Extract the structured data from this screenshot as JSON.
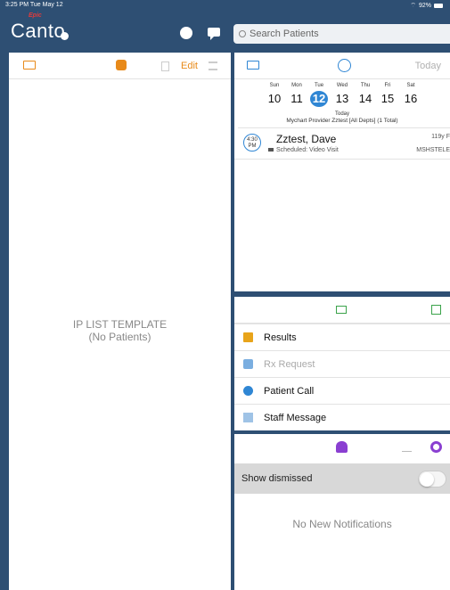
{
  "status_bar": {
    "time": "3:25 PM  Tue May 12",
    "battery": "92%"
  },
  "brand": {
    "epic": "Epic",
    "app_name": "Canto"
  },
  "icons": {
    "globe": "globe-icon",
    "chat": "chat-bubble-icon"
  },
  "search": {
    "placeholder": "Search Patients"
  },
  "patient_list": {
    "edit_label": "Edit",
    "empty_title": "IP LIST TEMPLATE",
    "empty_subtitle": "(No Patients)"
  },
  "schedule": {
    "today_label": "Today",
    "days": [
      {
        "name": "Sun",
        "num": "10",
        "selected": false
      },
      {
        "name": "Mon",
        "num": "11",
        "selected": false
      },
      {
        "name": "Tue",
        "num": "12",
        "selected": true
      },
      {
        "name": "Wed",
        "num": "13",
        "selected": false
      },
      {
        "name": "Thu",
        "num": "14",
        "selected": false
      },
      {
        "name": "Fri",
        "num": "15",
        "selected": false
      },
      {
        "name": "Sat",
        "num": "16",
        "selected": false
      }
    ],
    "selected_today": "Today",
    "provider": "Mychart Provider Zztest [All Depts] (1 Total)",
    "appointments": [
      {
        "time_top": "4:30",
        "time_bottom": "PM",
        "name": "Zztest, Dave",
        "status": "Scheduled: Video Visit",
        "age": "119y F",
        "dept": "MSHSTELE"
      }
    ]
  },
  "inbox": {
    "items": [
      {
        "label": "Results",
        "color": "#e8a41a"
      },
      {
        "label": "Rx Request",
        "color": "#7aaee0"
      },
      {
        "label": "Patient Call",
        "color": "#2f86d4"
      },
      {
        "label": "Staff Message",
        "color": "#9fc3e6"
      }
    ]
  },
  "notifications": {
    "show_dismissed": "Show dismissed",
    "empty": "No New Notifications"
  },
  "colors": {
    "accent_orange": "#e88a1a",
    "accent_blue": "#2f86d4",
    "accent_green": "#3aa34a",
    "accent_purple": "#8a3fd1",
    "frame_blue": "#2e4f73"
  }
}
